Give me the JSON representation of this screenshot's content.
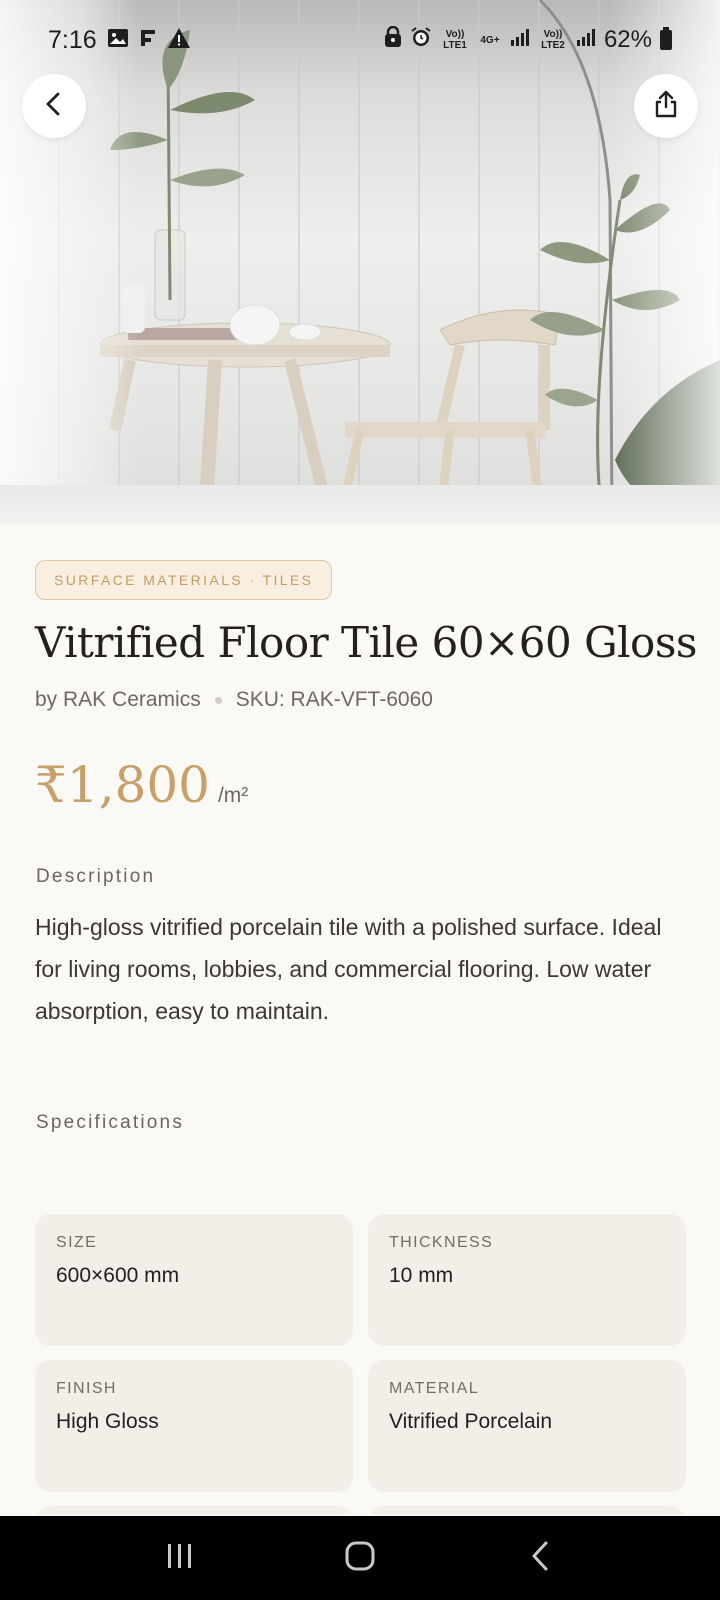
{
  "status_bar": {
    "time": "7:16",
    "left_icons": [
      "gallery-icon",
      "flipboard-icon",
      "warning-icon"
    ],
    "right_icons": [
      "lock-icon",
      "alarm-icon",
      "lte1-icon",
      "4g-icon",
      "signal-icon",
      "lte2-icon",
      "signal-icon"
    ],
    "lte1_label": "Vo)) LTE1",
    "g4_label": "4G+",
    "lte2_label": "Vo)) LTE2",
    "battery": "62%"
  },
  "hero": {
    "back_icon": "arrow-left-icon",
    "share_icon": "share-icon"
  },
  "product": {
    "category": "SURFACE MATERIALS · TILES",
    "title": "Vitrified Floor Tile 60×60 Gloss",
    "brand": "by RAK Ceramics",
    "sku": "SKU: RAK-VFT-6060",
    "price": "₹1,800",
    "price_unit": "/m²"
  },
  "description": {
    "label": "Description",
    "text": "High-gloss vitrified porcelain tile with a polished surface. Ideal for living rooms, lobbies, and commercial flooring. Low water absorption, easy to maintain."
  },
  "specifications": {
    "label": "Specifications",
    "items": [
      {
        "key": "SIZE",
        "value": "600×600 mm"
      },
      {
        "key": "THICKNESS",
        "value": "10 mm"
      },
      {
        "key": "FINISH",
        "value": "High Gloss"
      },
      {
        "key": "MATERIAL",
        "value": "Vitrified Porcelain"
      },
      {
        "key": "",
        "value": ""
      },
      {
        "key": "",
        "value": ""
      }
    ]
  },
  "nav": {
    "icons": [
      "recent-apps-icon",
      "home-icon",
      "back-icon"
    ]
  },
  "colors": {
    "accent": "#c6a067",
    "background": "#fbf9f6",
    "card": "#f2eee8"
  }
}
